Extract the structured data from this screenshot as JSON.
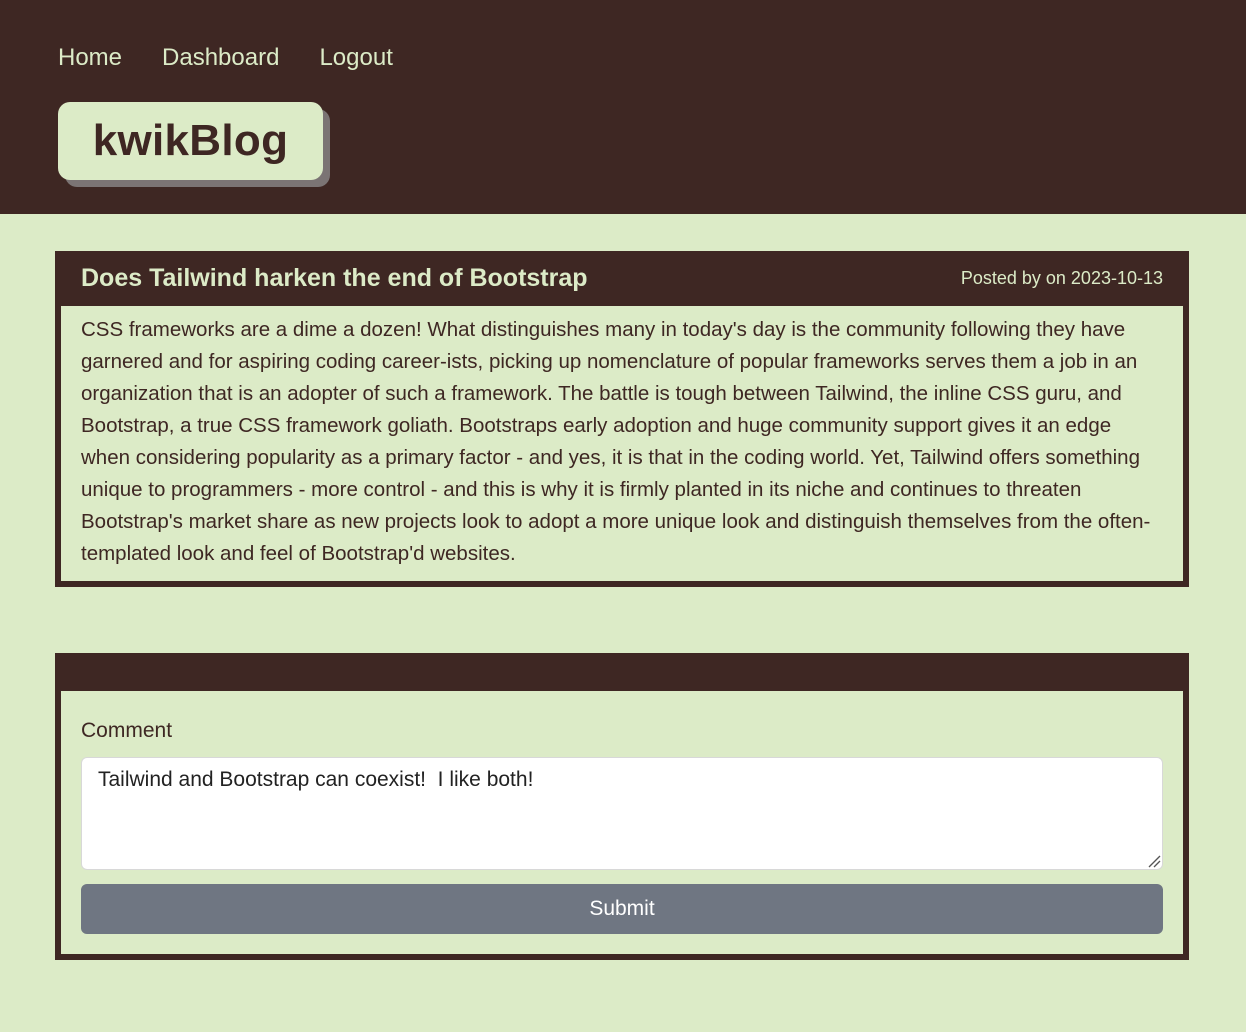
{
  "nav": {
    "home": "Home",
    "dashboard": "Dashboard",
    "logout": "Logout"
  },
  "brand": {
    "name": "kwikBlog"
  },
  "post": {
    "title": "Does Tailwind harken the end of Bootstrap",
    "meta": "Posted by on 2023-10-13",
    "body": "CSS frameworks are a dime a dozen! What distinguishes many in today's day is the community following they have garnered and for aspiring coding career-ists, picking up nomenclature of popular frameworks serves them a job in an organization that is an adopter of such a framework. The battle is tough between Tailwind, the inline CSS guru, and Bootstrap, a true CSS framework goliath. Bootstraps early adoption and huge community support gives it an edge when considering popularity as a primary factor - and yes, it is that in the coding world. Yet, Tailwind offers something unique to programmers - more control - and this is why it is firmly planted in its niche and continues to threaten Bootstrap's market share as new projects look to adopt a more unique look and distinguish themselves from the often-templated look and feel of Bootstrap'd websites."
  },
  "comment_form": {
    "label": "Comment",
    "value": "Tailwind and Bootstrap can coexist!  I like both!",
    "submit_label": "Submit"
  },
  "colors": {
    "dark": "#3e2723",
    "light": "#dcebc7",
    "button": "#6f7682"
  }
}
